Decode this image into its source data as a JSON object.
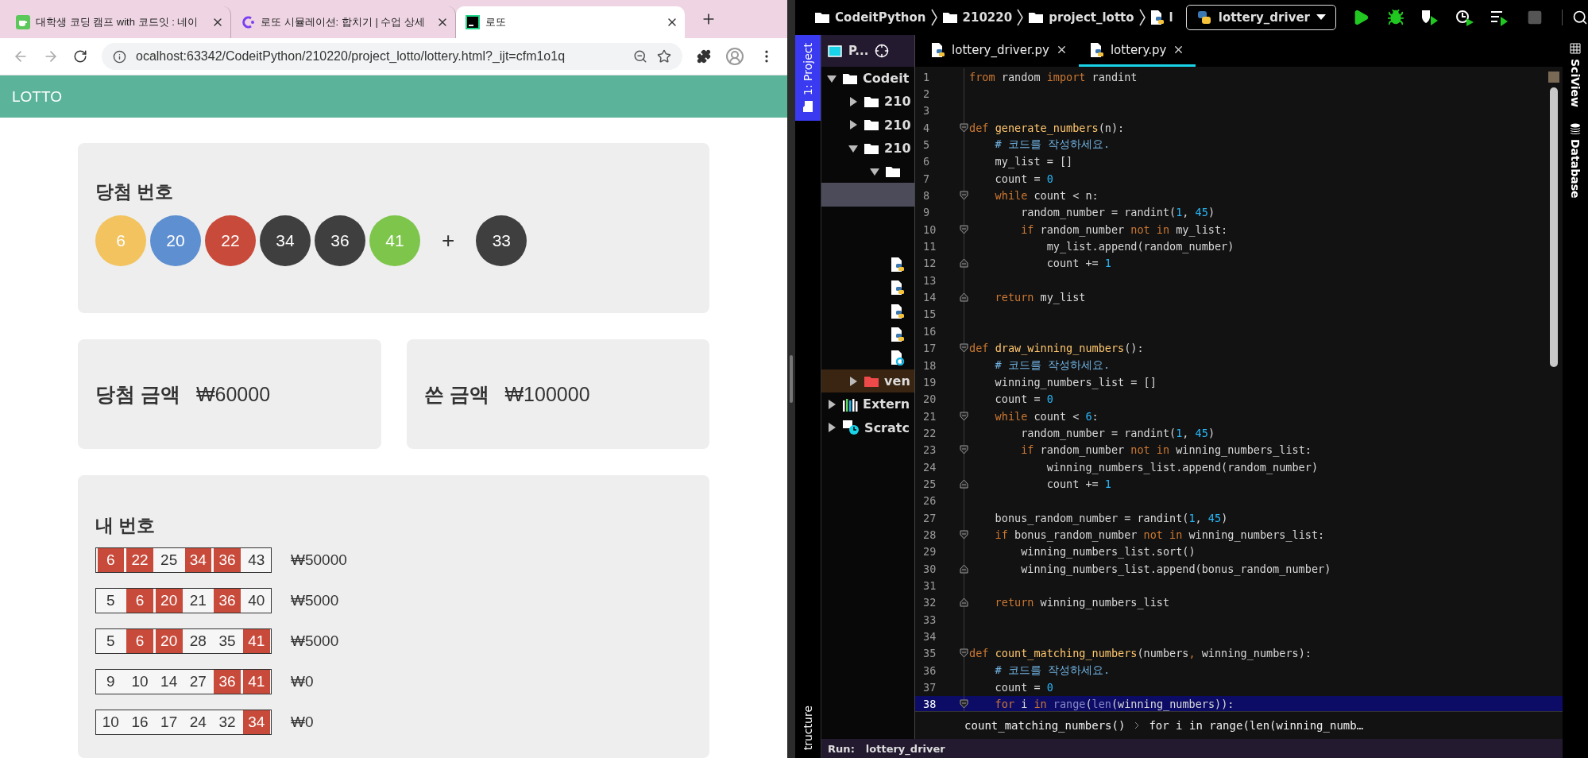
{
  "browser": {
    "tabs": [
      {
        "title": "대학생 코딩 캠프 with 코드잇 : 네이",
        "kind": "cup",
        "selected": false
      },
      {
        "title": "로또 시뮬레이션: 합치기 | 수업 상세",
        "kind": "codeit",
        "selected": false
      },
      {
        "title": "로또",
        "kind": "pycharm",
        "selected": true
      }
    ],
    "url": "ocalhost:63342/CodeitPython/210220/project_lotto/lottery.html?_ijt=cfm1o1q"
  },
  "page": {
    "header": "LOTTO",
    "winning": {
      "title": "당첨 번호",
      "balls": [
        {
          "number": "6",
          "color": "#f2c35f"
        },
        {
          "number": "20",
          "color": "#5e8fd0"
        },
        {
          "number": "22",
          "color": "#c84a3a"
        },
        {
          "number": "34",
          "color": "#3f3f3f"
        },
        {
          "number": "36",
          "color": "#3f3f3f"
        },
        {
          "number": "41",
          "color": "#7ec54c"
        }
      ],
      "plus": "+",
      "bonus": {
        "number": "33",
        "color": "#3f3f3f"
      }
    },
    "prize": {
      "label": "당첨 금액",
      "amount": "₩60000"
    },
    "spent": {
      "label": "쓴 금액",
      "amount": "₩100000"
    },
    "mine": {
      "title": "내 번호",
      "tickets": [
        {
          "numbers": [
            {
              "n": "6",
              "matched": true
            },
            {
              "n": "22",
              "matched": true
            },
            {
              "n": "25",
              "matched": false
            },
            {
              "n": "34",
              "matched": true
            },
            {
              "n": "36",
              "matched": true
            },
            {
              "n": "43",
              "matched": false
            }
          ],
          "prize": "₩50000"
        },
        {
          "numbers": [
            {
              "n": "5",
              "matched": false
            },
            {
              "n": "6",
              "matched": true
            },
            {
              "n": "20",
              "matched": true
            },
            {
              "n": "21",
              "matched": false
            },
            {
              "n": "36",
              "matched": true
            },
            {
              "n": "40",
              "matched": false
            }
          ],
          "prize": "₩5000"
        },
        {
          "numbers": [
            {
              "n": "5",
              "matched": false
            },
            {
              "n": "6",
              "matched": true
            },
            {
              "n": "20",
              "matched": true
            },
            {
              "n": "28",
              "matched": false
            },
            {
              "n": "35",
              "matched": false
            },
            {
              "n": "41",
              "matched": true
            }
          ],
          "prize": "₩5000"
        },
        {
          "numbers": [
            {
              "n": "9",
              "matched": false
            },
            {
              "n": "10",
              "matched": false
            },
            {
              "n": "14",
              "matched": false
            },
            {
              "n": "27",
              "matched": false
            },
            {
              "n": "36",
              "matched": true
            },
            {
              "n": "41",
              "matched": true
            }
          ],
          "prize": "₩0"
        },
        {
          "numbers": [
            {
              "n": "10",
              "matched": false
            },
            {
              "n": "16",
              "matched": false
            },
            {
              "n": "17",
              "matched": false
            },
            {
              "n": "24",
              "matched": false
            },
            {
              "n": "32",
              "matched": false
            },
            {
              "n": "34",
              "matched": true
            }
          ],
          "prize": "₩0"
        }
      ]
    }
  },
  "ide": {
    "breadcrumbs": [
      {
        "label": "CodeitPython",
        "kind": "folder"
      },
      {
        "label": "210220",
        "kind": "folder"
      },
      {
        "label": "project_lotto",
        "kind": "folder"
      },
      {
        "label": "l",
        "kind": "python-file"
      }
    ],
    "run_config": "lottery_driver",
    "left_tools": [
      {
        "label": "1: Project",
        "selected": true
      },
      {
        "label": "tructure",
        "selected": false
      }
    ],
    "right_tools": [
      {
        "label": "SciView",
        "kind": "sciview"
      },
      {
        "label": "Database",
        "kind": "database"
      }
    ],
    "project": {
      "title": "P...",
      "tree": [
        {
          "label": "Codeit",
          "kind": "folder",
          "expanded": true,
          "selected": false,
          "children": [
            {
              "label": "210",
              "kind": "folder",
              "expanded": false,
              "selected": false
            },
            {
              "label": "210",
              "kind": "folder",
              "expanded": false,
              "selected": false
            },
            {
              "label": "210",
              "kind": "folder",
              "expanded": true,
              "selected": false,
              "children": [
                {
                  "kind": "folder",
                  "expanded": true,
                  "selected": false,
                  "children": [
                    {
                      "kind": "file",
                      "selected": true
                    },
                    {
                      "kind": "file",
                      "selected": false
                    },
                    {
                      "kind": "file",
                      "selected": false
                    },
                    {
                      "kind": "python-file",
                      "selected": false
                    },
                    {
                      "kind": "python-file",
                      "selected": false
                    },
                    {
                      "kind": "python-file",
                      "selected": false
                    },
                    {
                      "kind": "python-file",
                      "selected": false
                    },
                    {
                      "kind": "config-file",
                      "selected": false
                    }
                  ]
                }
              ]
            },
            {
              "label": "ven",
              "kind": "excluded-folder",
              "expanded": false,
              "selected": false
            }
          ]
        },
        {
          "label": "Extern",
          "kind": "libraries",
          "expanded": false,
          "selected": false
        },
        {
          "label": "Scratc",
          "kind": "scratches",
          "expanded": false,
          "selected": false
        }
      ]
    },
    "editor_tabs": [
      {
        "label": "lottery_driver.py",
        "selected": false
      },
      {
        "label": "lottery.py",
        "selected": true
      }
    ],
    "lines": [
      {
        "no": "1",
        "tokens": [
          {
            "kind": "kw",
            "text": "from"
          },
          {
            "kind": "p",
            "text": " random "
          },
          {
            "kind": "kw",
            "text": "import"
          },
          {
            "kind": "p",
            "text": " randint"
          }
        ]
      },
      {
        "no": "2"
      },
      {
        "no": "3"
      },
      {
        "no": "4",
        "fold_start": true,
        "tokens": [
          {
            "kind": "kw",
            "text": "def "
          },
          {
            "kind": "fn",
            "text": "generate_numbers"
          },
          {
            "kind": "p",
            "text": "(n):"
          }
        ]
      },
      {
        "no": "5",
        "tokens": [
          {
            "kind": "cm",
            "text": "    # 코드를 작성하세요."
          }
        ]
      },
      {
        "no": "6",
        "tokens": [
          {
            "kind": "p",
            "text": "    my_list = []"
          }
        ]
      },
      {
        "no": "7",
        "tokens": [
          {
            "kind": "p",
            "text": "    count = "
          },
          {
            "kind": "num",
            "text": "0"
          }
        ]
      },
      {
        "no": "8",
        "fold_start": true,
        "tokens": [
          {
            "kind": "kw",
            "text": "    while"
          },
          {
            "kind": "p",
            "text": " count < n:"
          }
        ]
      },
      {
        "no": "9",
        "tokens": [
          {
            "kind": "p",
            "text": "        random_number = randint("
          },
          {
            "kind": "num",
            "text": "1"
          },
          {
            "kind": "p",
            "text": ", "
          },
          {
            "kind": "num",
            "text": "45"
          },
          {
            "kind": "p",
            "text": ")"
          }
        ]
      },
      {
        "no": "10",
        "fold_start": true,
        "tokens": [
          {
            "kind": "kw",
            "text": "        if"
          },
          {
            "kind": "p",
            "text": " random_number "
          },
          {
            "kind": "kw",
            "text": "not in"
          },
          {
            "kind": "p",
            "text": " my_list:"
          }
        ]
      },
      {
        "no": "11",
        "tokens": [
          {
            "kind": "p",
            "text": "            my_list.append(random_number)"
          }
        ]
      },
      {
        "no": "12",
        "fold_end": true,
        "tokens": [
          {
            "kind": "p",
            "text": "            count += "
          },
          {
            "kind": "num",
            "text": "1"
          }
        ]
      },
      {
        "no": "13"
      },
      {
        "no": "14",
        "fold_end": true,
        "tokens": [
          {
            "kind": "kw",
            "text": "    return"
          },
          {
            "kind": "p",
            "text": " my_list"
          }
        ]
      },
      {
        "no": "15"
      },
      {
        "no": "16"
      },
      {
        "no": "17",
        "fold_start": true,
        "tokens": [
          {
            "kind": "kw",
            "text": "def "
          },
          {
            "kind": "fn",
            "text": "draw_winning_numbers"
          },
          {
            "kind": "p",
            "text": "():"
          }
        ]
      },
      {
        "no": "18",
        "tokens": [
          {
            "kind": "cm",
            "text": "    # 코드를 작성하세요."
          }
        ]
      },
      {
        "no": "19",
        "tokens": [
          {
            "kind": "p",
            "text": "    winning_numbers_list = []"
          }
        ]
      },
      {
        "no": "20",
        "tokens": [
          {
            "kind": "p",
            "text": "    count = "
          },
          {
            "kind": "num",
            "text": "0"
          }
        ]
      },
      {
        "no": "21",
        "fold_start": true,
        "tokens": [
          {
            "kind": "kw",
            "text": "    while"
          },
          {
            "kind": "p",
            "text": " count < "
          },
          {
            "kind": "num",
            "text": "6"
          },
          {
            "kind": "p",
            "text": ":"
          }
        ]
      },
      {
        "no": "22",
        "tokens": [
          {
            "kind": "p",
            "text": "        random_number = randint("
          },
          {
            "kind": "num",
            "text": "1"
          },
          {
            "kind": "p",
            "text": ", "
          },
          {
            "kind": "num",
            "text": "45"
          },
          {
            "kind": "p",
            "text": ")"
          }
        ]
      },
      {
        "no": "23",
        "fold_start": true,
        "tokens": [
          {
            "kind": "kw",
            "text": "        if"
          },
          {
            "kind": "p",
            "text": " random_number "
          },
          {
            "kind": "kw",
            "text": "not in"
          },
          {
            "kind": "p",
            "text": " winning_numbers_list:"
          }
        ]
      },
      {
        "no": "24",
        "tokens": [
          {
            "kind": "p",
            "text": "            winning_numbers_list.append(random_number)"
          }
        ]
      },
      {
        "no": "25",
        "fold_end": true,
        "tokens": [
          {
            "kind": "p",
            "text": "            count += "
          },
          {
            "kind": "num",
            "text": "1"
          }
        ]
      },
      {
        "no": "26"
      },
      {
        "no": "27",
        "tokens": [
          {
            "kind": "p",
            "text": "    bonus_random_number = randint("
          },
          {
            "kind": "num",
            "text": "1"
          },
          {
            "kind": "p",
            "text": ", "
          },
          {
            "kind": "num",
            "text": "45"
          },
          {
            "kind": "p",
            "text": ")"
          }
        ]
      },
      {
        "no": "28",
        "fold_start": true,
        "tokens": [
          {
            "kind": "kw",
            "text": "    if"
          },
          {
            "kind": "p",
            "text": " bonus_random_number "
          },
          {
            "kind": "kw",
            "text": "not in"
          },
          {
            "kind": "p",
            "text": " winning_numbers_list:"
          }
        ]
      },
      {
        "no": "29",
        "tokens": [
          {
            "kind": "p",
            "text": "        winning_numbers_list.sort()"
          }
        ]
      },
      {
        "no": "30",
        "fold_end": true,
        "tokens": [
          {
            "kind": "p",
            "text": "        winning_numbers_list.append(bonus_random_number)"
          }
        ]
      },
      {
        "no": "31"
      },
      {
        "no": "32",
        "fold_end": true,
        "tokens": [
          {
            "kind": "kw",
            "text": "    return"
          },
          {
            "kind": "p",
            "text": " winning_numbers_list"
          }
        ]
      },
      {
        "no": "33"
      },
      {
        "no": "34"
      },
      {
        "no": "35",
        "fold_start": true,
        "tokens": [
          {
            "kind": "kw",
            "text": "def "
          },
          {
            "kind": "fn",
            "text": "count_matching_numbers"
          },
          {
            "kind": "p",
            "text": "(numbers"
          },
          {
            "kind": "kw",
            "text": ","
          },
          {
            "kind": "p",
            "text": " winning_numbers):"
          }
        ]
      },
      {
        "no": "36",
        "tokens": [
          {
            "kind": "cm",
            "text": "    # 코드를 작성하세요."
          }
        ]
      },
      {
        "no": "37",
        "tokens": [
          {
            "kind": "p",
            "text": "    count = "
          },
          {
            "kind": "num",
            "text": "0"
          }
        ]
      },
      {
        "no": "38",
        "fold_start": true,
        "highlighted": true,
        "tokens": [
          {
            "kind": "kw",
            "text": "    for"
          },
          {
            "kind": "p",
            "text": " i "
          },
          {
            "kind": "kw",
            "text": "in"
          },
          {
            "kind": "bi",
            "text": " range"
          },
          {
            "kind": "p",
            "text": "("
          },
          {
            "kind": "bi",
            "text": "len"
          },
          {
            "kind": "p",
            "text": "(winning_numbers)):"
          }
        ]
      }
    ],
    "breadcrumb": [
      "count_matching_numbers()",
      "for i in range(len(winning_numb…"
    ],
    "run": {
      "label": "Run:",
      "config": "lottery_driver"
    }
  }
}
